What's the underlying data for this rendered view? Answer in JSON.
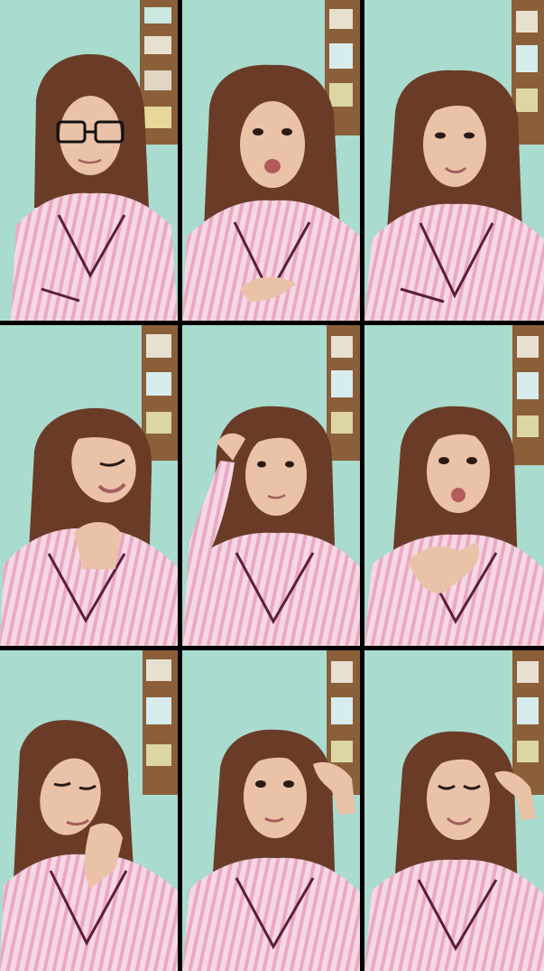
{
  "collage": {
    "rows": 3,
    "columns": 3,
    "frames": [
      {
        "pose": "glasses-on"
      },
      {
        "pose": "looking-up-mouth-open"
      },
      {
        "pose": "speaking"
      },
      {
        "pose": "head-tilt-smile"
      },
      {
        "pose": "hand-in-hair"
      },
      {
        "pose": "hand-on-chest-surprised"
      },
      {
        "pose": "hand-on-neck-head-tilt"
      },
      {
        "pose": "pointing-at-temple"
      },
      {
        "pose": "pointing-at-temple-smile"
      }
    ]
  },
  "colors": {
    "wall": "#a9dbcf",
    "shirt": "#f6d7e3",
    "stripe": "#e9a9c3",
    "piping": "#5b1d3f",
    "hair": "#6a3c28",
    "skin": "#eac2a8",
    "shelf": "#9b6b40",
    "separator": "#000000"
  }
}
